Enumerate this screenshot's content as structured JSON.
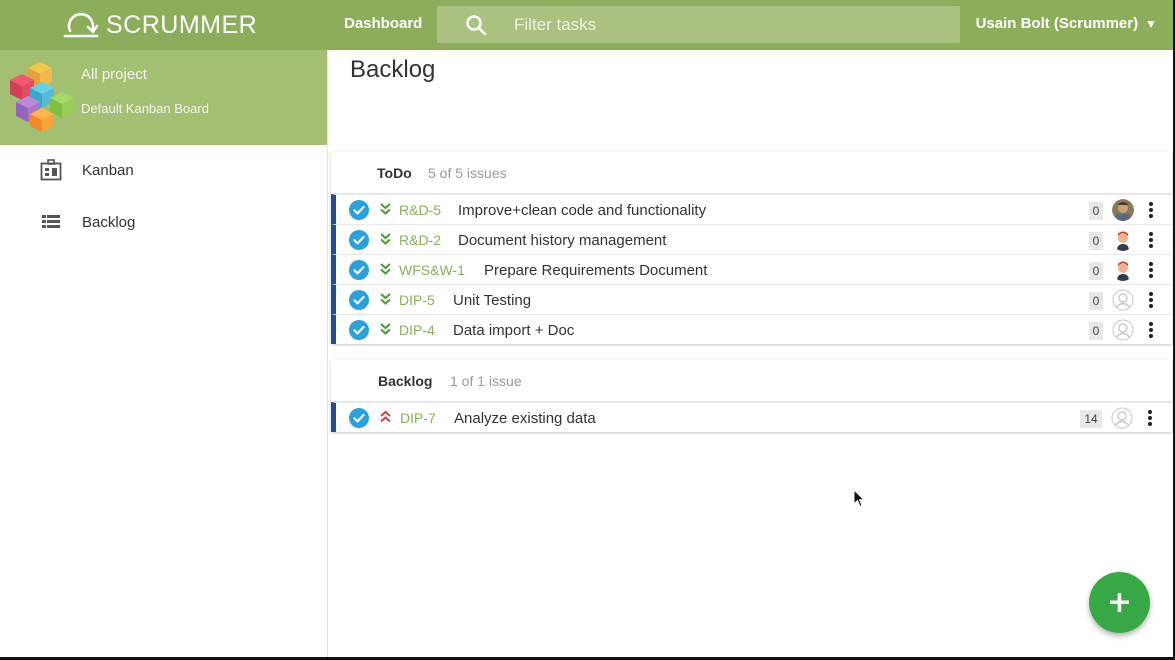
{
  "app": {
    "name": "SCRUMMER",
    "brand_color": "#8cae5a",
    "accent_color": "#37a846"
  },
  "topbar": {
    "dashboard_label": "Dashboard",
    "search_placeholder": "Filter tasks",
    "user_label": "Usain Bolt (Scrummer)",
    "user_caret": "▼"
  },
  "sidebar": {
    "project_name": "All project",
    "project_subtitle": "Default Kanban Board",
    "items": [
      {
        "label": "Kanban",
        "icon": "kanban-board-icon"
      },
      {
        "label": "Backlog",
        "icon": "list-icon"
      }
    ]
  },
  "main": {
    "title": "Backlog",
    "sections": [
      {
        "title": "ToDo",
        "count_text": "5 of 5 issues",
        "issues": [
          {
            "key": "R&D-5",
            "title": "Improve+clean code and functionality",
            "estimate": "0",
            "priority": "low",
            "assignee": "photo-avatar"
          },
          {
            "key": "R&D-2",
            "title": "Document history management",
            "estimate": "0",
            "priority": "low",
            "assignee": "user-avatar"
          },
          {
            "key": "WFS&W-1",
            "title": "Prepare Requirements Document",
            "estimate": "0",
            "priority": "low",
            "assignee": "user-avatar"
          },
          {
            "key": "DIP-5",
            "title": "Unit Testing",
            "estimate": "0",
            "priority": "low",
            "assignee": "unassigned"
          },
          {
            "key": "DIP-4",
            "title": "Data import + Doc",
            "estimate": "0",
            "priority": "low",
            "assignee": "unassigned"
          }
        ]
      },
      {
        "title": "Backlog",
        "count_text": "1 of 1 issue",
        "issues": [
          {
            "key": "DIP-7",
            "title": "Analyze existing data",
            "estimate": "14",
            "priority": "high",
            "assignee": "unassigned"
          }
        ]
      }
    ]
  },
  "fab": {
    "label": "+"
  }
}
